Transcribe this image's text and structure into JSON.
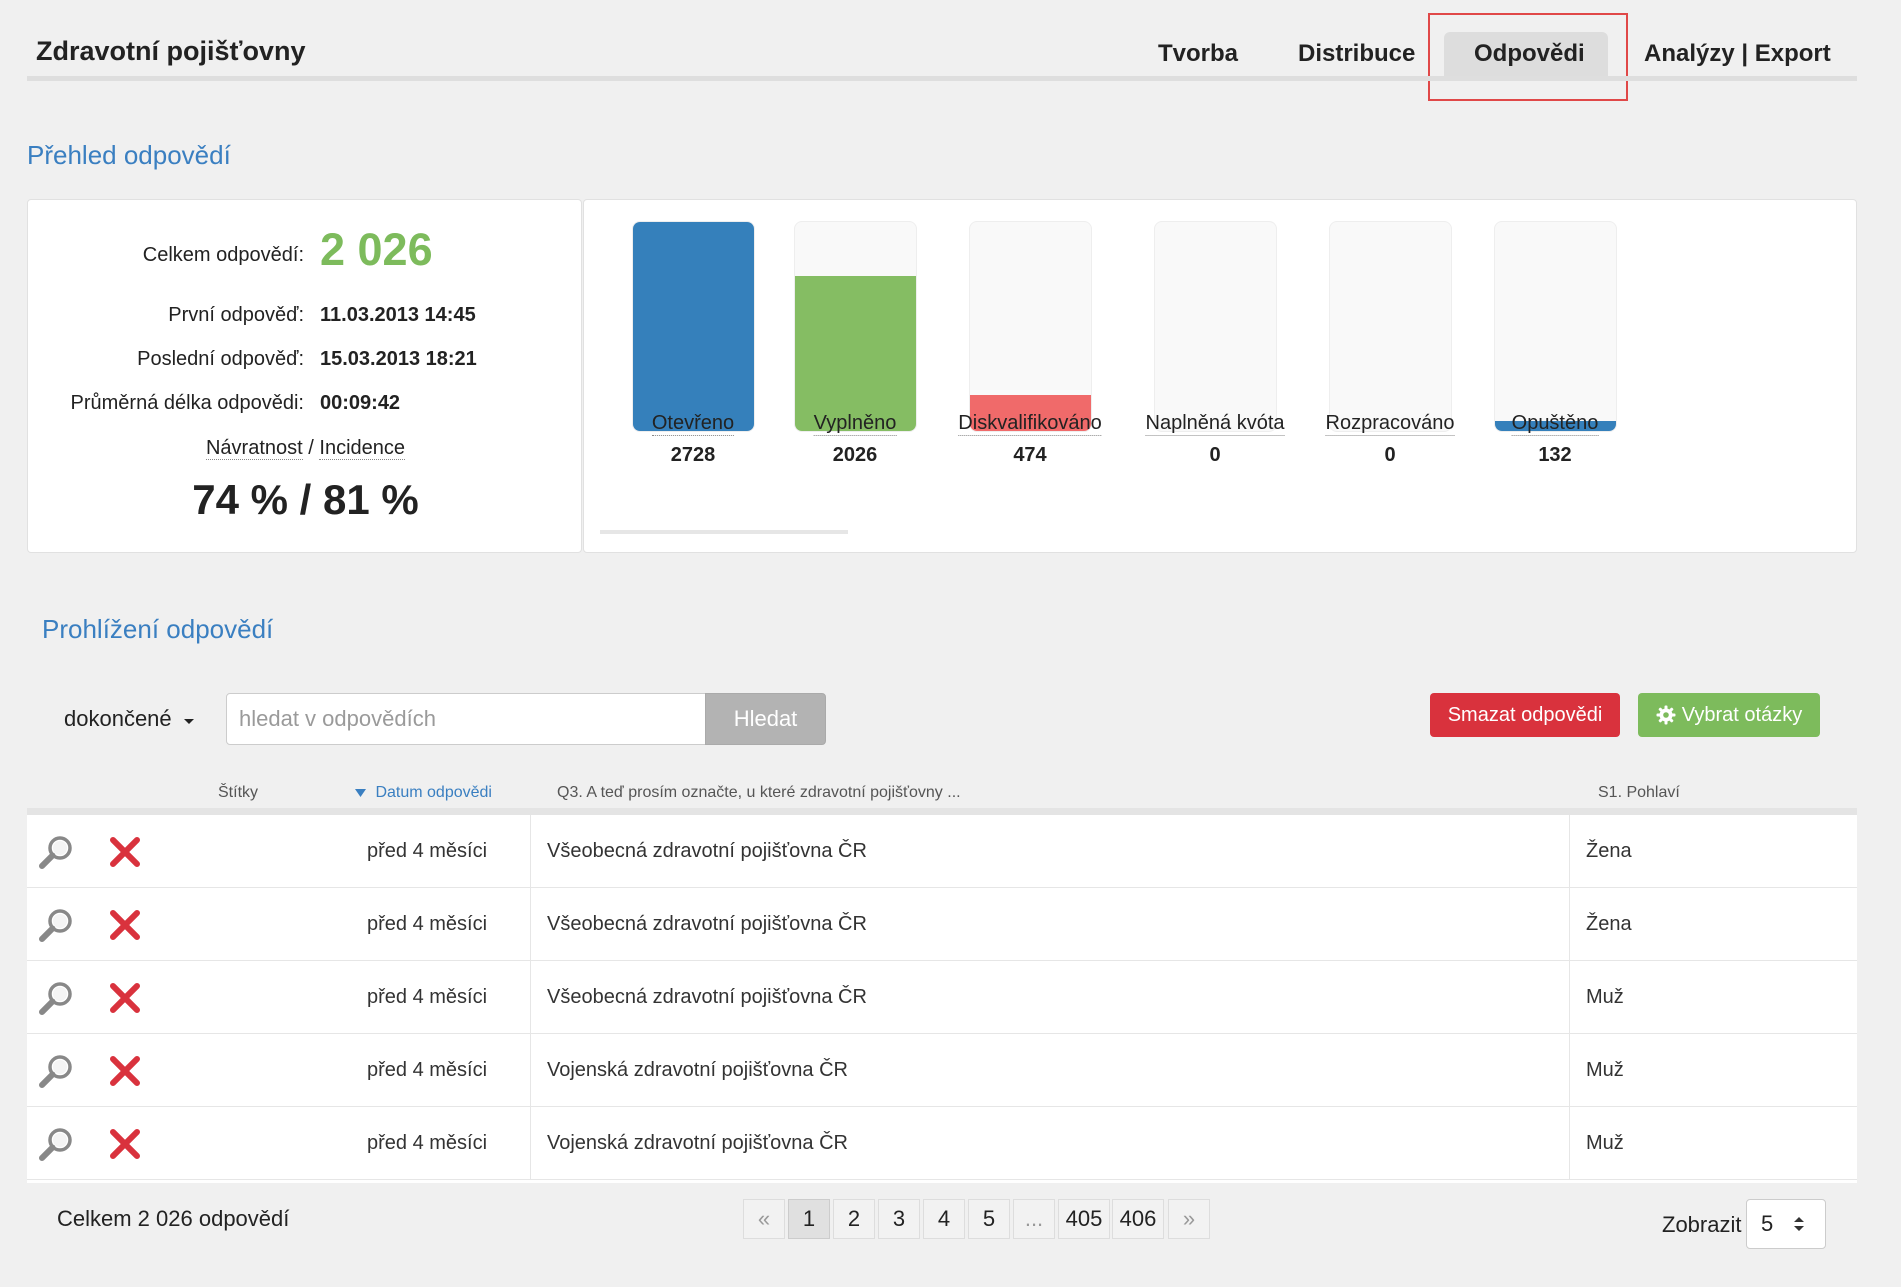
{
  "header": {
    "title": "Zdravotní pojišťovny",
    "tabs": [
      {
        "label": "Tvorba",
        "active": false
      },
      {
        "label": "Distribuce",
        "active": false
      },
      {
        "label": "Odpovědi",
        "active": true
      },
      {
        "label": "Analýzy | Export",
        "active": false
      }
    ]
  },
  "overview": {
    "title": "Přehled odpovědí",
    "total_label": "Celkem odpovědí:",
    "total_value": "2 026",
    "first_label": "První odpověď:",
    "first_value": "11.03.2013 14:45",
    "last_label": "Poslední odpověď:",
    "last_value": "15.03.2013 18:21",
    "avg_label": "Průměrná délka odpovědi:",
    "avg_value": "00:09:42",
    "return_label": "Návratnost",
    "separator": "/",
    "incidence_label": "Incidence",
    "rates_value": "74 % / 81 %"
  },
  "chart_data": {
    "type": "bar",
    "categories": [
      "Otevřeno",
      "Vyplněno",
      "Diskvalifikováno",
      "Naplněná kvóta",
      "Rozpracováno",
      "Opuštěno"
    ],
    "values": [
      2728,
      2026,
      474,
      0,
      0,
      132
    ],
    "colors": [
      "#3580bb",
      "#85bd63",
      "#f06a6a",
      "#3580bb",
      "#3580bb",
      "#3580bb"
    ],
    "ylim": [
      0,
      2728
    ]
  },
  "browse": {
    "title": "Prohlížení odpovědí",
    "filter_value": "dokončené",
    "search_placeholder": "hledat v odpovědích",
    "search_button": "Hledat",
    "delete_button": "Smazat odpovědi",
    "choose_button": "Vybrat otázky"
  },
  "table": {
    "columns": {
      "tags": "Štítky",
      "date": "Datum odpovědi",
      "q3": "Q3. A teď prosím označte, u které zdravotní pojišťovny ...",
      "s1": "S1. Pohlaví"
    },
    "rows": [
      {
        "date": "před 4 měsíci",
        "q3": "Všeobecná zdravotní pojišťovna ČR",
        "s1": "Žena"
      },
      {
        "date": "před 4 měsíci",
        "q3": "Všeobecná zdravotní pojišťovna ČR",
        "s1": "Žena"
      },
      {
        "date": "před 4 měsíci",
        "q3": "Všeobecná zdravotní pojišťovna ČR",
        "s1": "Muž"
      },
      {
        "date": "před 4 měsíci",
        "q3": "Vojenská zdravotní pojišťovna ČR",
        "s1": "Muž"
      },
      {
        "date": "před 4 měsíci",
        "q3": "Vojenská zdravotní pojišťovna ČR",
        "s1": "Muž"
      }
    ]
  },
  "footer": {
    "total_text": "Celkem 2 026 odpovědí",
    "pages": [
      "«",
      "1",
      "2",
      "3",
      "4",
      "5",
      "...",
      "405",
      "406",
      "»"
    ],
    "active_page": "1",
    "show_label": "Zobrazit",
    "page_size": "5"
  }
}
